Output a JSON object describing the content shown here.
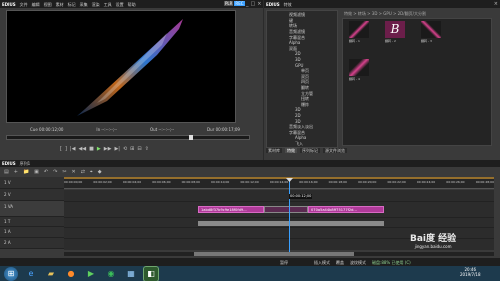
{
  "preview": {
    "app_name": "EDIUS",
    "menu": [
      "文件",
      "编辑",
      "视图",
      "素材",
      "标记",
      "采集",
      "渲染",
      "工具",
      "设置",
      "帮助"
    ],
    "mode_labels": [
      "PLR",
      "REC"
    ],
    "timecodes": {
      "cue": "Cue 00:00:12;00",
      "in": "In --:--:--;--",
      "out": "Out --:--:--;--",
      "dur": "Dur 00:00:17;09"
    }
  },
  "effects_panel": {
    "app_name": "EDIUS",
    "title": "特效",
    "breadcrumb": "特效 > 转场 > 3D > GPU > 2D/翻页/大分割",
    "tree_labels": [
      "视频滤镜",
      "键",
      "转场",
      "音频滤镜",
      "字幕混合",
      "Alpha",
      "双面",
      "2D",
      "3D",
      "GPU",
      "单页",
      "双页",
      "四页",
      "翻转",
      "立方管",
      "扭转",
      "爆炸",
      "3D",
      "2D",
      "3D",
      "音频淡入淡出",
      "字幕混合",
      "Alpha",
      "飞入",
      "划像",
      "柔化飞入",
      "柔化划像",
      "其他"
    ],
    "thumbnails": [
      {
        "label": "翻转 - 1",
        "letter": ""
      },
      {
        "label": "翻转 - 2",
        "letter": "B"
      },
      {
        "label": "翻转 - 3",
        "letter": ""
      },
      {
        "label": "翻转 - 4",
        "letter": ""
      }
    ],
    "tabs": [
      "素材库",
      "特效",
      "序列标记",
      "源文件浏览"
    ]
  },
  "timeline": {
    "app_name": "EDIUS",
    "sequence": "序列1",
    "playhead_timecode": "00:00:12;00",
    "ruler_marks": [
      "00:00:00;00",
      "00:00:02;00",
      "00:00:04;00",
      "00:00:06;00",
      "00:00:08;00",
      "00:00:10;00",
      "00:00:12;00",
      "00:00:14;00",
      "00:00:16;00",
      "00:00:18;00",
      "00:00:20;00",
      "00:00:22;00",
      "00:00:24;00",
      "00:00:26;00",
      "00:00:28;00"
    ],
    "tracks": [
      {
        "name": "1 V"
      },
      {
        "name": "2 V"
      },
      {
        "name": "1 VA"
      },
      {
        "name": "1 T"
      },
      {
        "name": "1 A"
      },
      {
        "name": "2 A"
      }
    ],
    "clips": [
      {
        "label": "1abd8f37b9c9e18f0fd9..."
      },
      {
        "label": "070a5a44b8ff75177f2d..."
      }
    ],
    "status_left": "暂停",
    "status_right": [
      "插入模式",
      "覆盖",
      "波纹模式"
    ],
    "disk_label": "磁盘:88% 已使用 (C)"
  },
  "taskbar": {
    "apps": [
      "windows-start",
      "ie",
      "folder",
      "firefox",
      "player",
      "chrome",
      "photos",
      "edius"
    ],
    "time": "20:46",
    "date": "2019/7/18",
    "watermark_brand": "Bai度 经验",
    "watermark_url": "jingyan.baidu.com"
  },
  "colors": {
    "accent": "#3aa0ff",
    "clip": "#b03a9a",
    "ruler_orange": "#e0a030",
    "taskbar": "#1d3a4d"
  }
}
